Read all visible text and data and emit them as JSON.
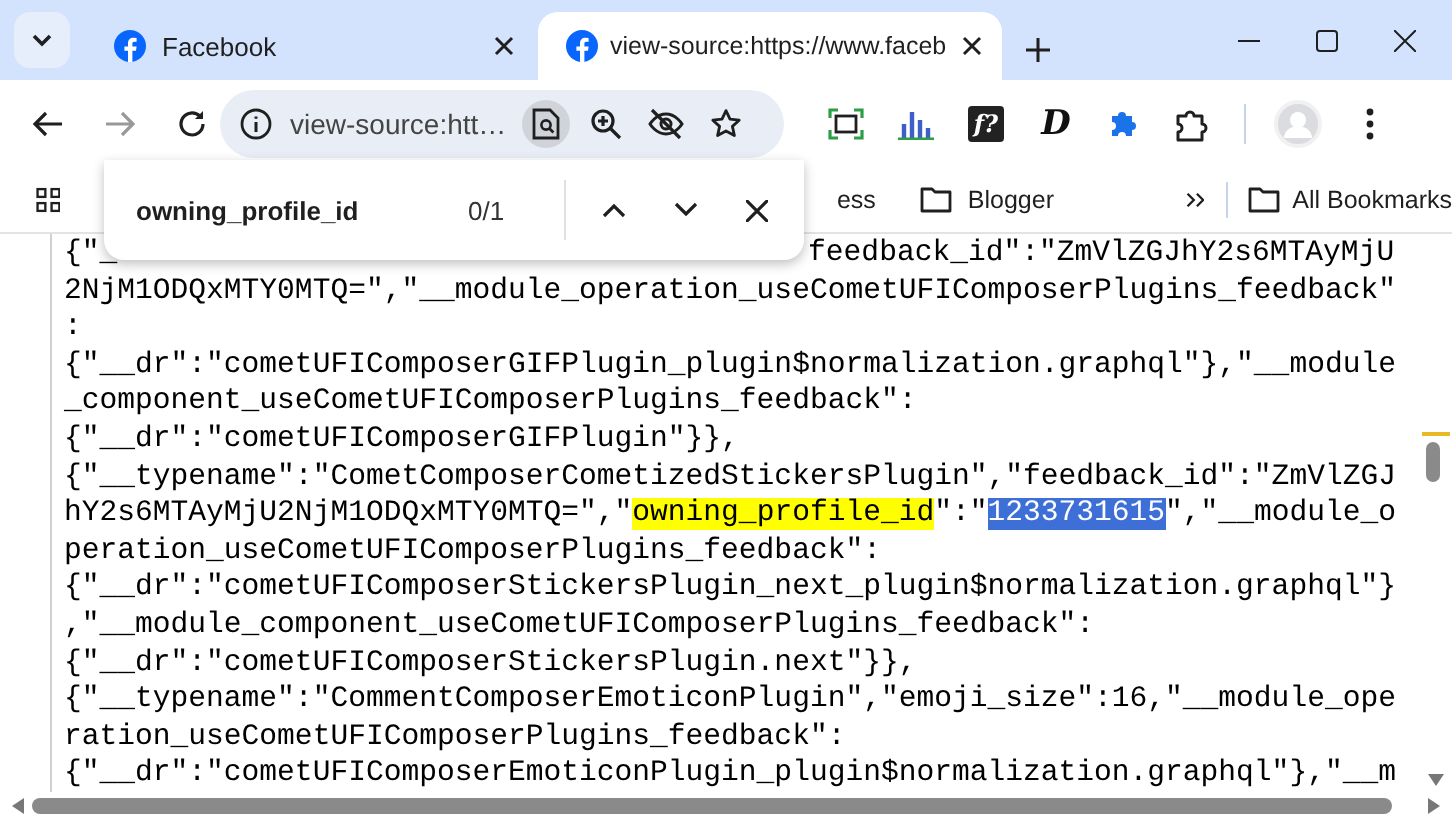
{
  "tabs": [
    {
      "title": "Facebook",
      "selected": false
    },
    {
      "title": "view-source:https://www.faceb",
      "selected": true
    }
  ],
  "address_bar": {
    "value": "view-source:htt…"
  },
  "extensions": [
    {
      "kind": "capture"
    },
    {
      "kind": "chart"
    },
    {
      "kind": "letter",
      "label": "f?"
    },
    {
      "kind": "script",
      "label": "D"
    },
    {
      "kind": "puzzle-filled"
    }
  ],
  "bookmarks": [
    {
      "kind": "link",
      "label": "ess"
    },
    {
      "kind": "folder",
      "label": "Blogger"
    }
  ],
  "all_bookmarks": {
    "label": "All Bookmarks"
  },
  "find_bar": {
    "query": "owning_profile_id",
    "count": "0/1"
  },
  "source_lines": [
    [
      {
        "kind": "plain",
        "text": "{\"_"
      },
      {
        "kind": "after_overlay",
        "text": "feedback_id\":\"ZmVlZGJhY2s6MTAyMjU"
      }
    ],
    [
      {
        "kind": "plain",
        "text": "2NjM1ODQxMTY0MTQ=\",\"__module_operation_useCometUFIComposerPlugins_feedback\""
      }
    ],
    [
      {
        "kind": "plain",
        "text": ":"
      }
    ],
    [
      {
        "kind": "plain",
        "text": "{\"__dr\":\"cometUFIComposerGIFPlugin_plugin$normalization.graphql\"},\"__module"
      }
    ],
    [
      {
        "kind": "plain",
        "text": "_component_useCometUFIComposerPlugins_feedback\":"
      }
    ],
    [
      {
        "kind": "plain",
        "text": "{\"__dr\":\"cometUFIComposerGIFPlugin\"}},"
      }
    ],
    [
      {
        "kind": "plain",
        "text": "{\"__typename\":\"CometComposerCometizedStickersPlugin\",\"feedback_id\":\"ZmVlZGJ"
      }
    ],
    [
      {
        "kind": "plain",
        "text": "hY2s6MTAyMjU2NjM1ODQxMTY0MTQ=\",\""
      },
      {
        "kind": "match",
        "text": "owning_profile_id"
      },
      {
        "kind": "plain",
        "text": "\":\""
      },
      {
        "kind": "selection",
        "text": "1233731615"
      },
      {
        "kind": "plain",
        "text": "\",\"__module_o"
      }
    ],
    [
      {
        "kind": "plain",
        "text": "peration_useCometUFIComposerPlugins_feedback\":"
      }
    ],
    [
      {
        "kind": "plain",
        "text": "{\"__dr\":\"cometUFIComposerStickersPlugin_next_plugin$normalization.graphql\"}"
      }
    ],
    [
      {
        "kind": "plain",
        "text": ",\"__module_component_useCometUFIComposerPlugins_feedback\":"
      }
    ],
    [
      {
        "kind": "plain",
        "text": "{\"__dr\":\"cometUFIComposerStickersPlugin.next\"}},"
      }
    ],
    [
      {
        "kind": "plain",
        "text": "{\"__typename\":\"CommentComposerEmoticonPlugin\",\"emoji_size\":16,\"__module_ope"
      }
    ],
    [
      {
        "kind": "plain",
        "text": "ration_useCometUFIComposerPlugins_feedback\":"
      }
    ],
    [
      {
        "kind": "plain",
        "text": "{\"__dr\":\"cometUFIComposerEmoticonPlugin_plugin$normalization.graphql\"},\"__m"
      }
    ]
  ]
}
